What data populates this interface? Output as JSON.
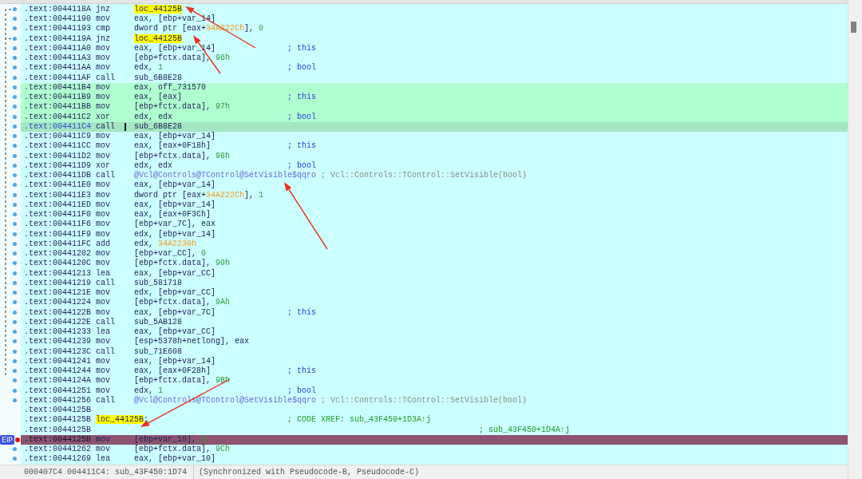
{
  "listing": {
    "rows": [
      {
        "address": ".text:0044118A",
        "mnemonic": "jnz",
        "operand": [
          {
            "text": "loc_44125B",
            "kind": "label"
          }
        ],
        "kind": "none",
        "dot": true
      },
      {
        "address": ".text:00441190",
        "mnemonic": "mov",
        "operand": [
          {
            "text": "eax, [ebp+var_14]",
            "kind": "plain"
          }
        ],
        "kind": "none",
        "dot": true
      },
      {
        "address": ".text:00441193",
        "mnemonic": "cmp",
        "operand": [
          {
            "text": "dword ptr [eax+",
            "kind": "plain"
          },
          {
            "text": "34A222Ch",
            "kind": "number"
          },
          {
            "text": "], ",
            "kind": "plain"
          },
          {
            "text": "0",
            "kind": "immediate"
          }
        ],
        "kind": "none",
        "dot": true
      },
      {
        "address": ".text:0044119A",
        "mnemonic": "jnz",
        "operand": [
          {
            "text": "loc_44125B",
            "kind": "label"
          }
        ],
        "kind": "none",
        "dot": true
      },
      {
        "address": ".text:004411A0",
        "mnemonic": "mov",
        "operand": [
          {
            "text": "eax, [ebp+var_14]",
            "kind": "plain"
          }
        ],
        "comment": {
          "text": "; this",
          "kind": "hint"
        },
        "kind": "none",
        "dot": true
      },
      {
        "address": ".text:004411A3",
        "mnemonic": "mov",
        "operand": [
          {
            "text": "[ebp+fctx.data], ",
            "kind": "plain"
          },
          {
            "text": "96h",
            "kind": "immediate"
          }
        ],
        "kind": "none",
        "dot": true
      },
      {
        "address": ".text:004411AA",
        "mnemonic": "mov",
        "operand": [
          {
            "text": "edx, ",
            "kind": "plain"
          },
          {
            "text": "1",
            "kind": "immediate"
          }
        ],
        "comment": {
          "text": "; bool",
          "kind": "hint"
        },
        "kind": "none",
        "dot": true
      },
      {
        "address": ".text:004411AF",
        "mnemonic": "call",
        "operand": [
          {
            "text": "sub_6B8E28",
            "kind": "plain"
          }
        ],
        "kind": "none",
        "dot": true
      },
      {
        "address": ".text:004411B4",
        "mnemonic": "mov",
        "operand": [
          {
            "text": "eax, off_731570",
            "kind": "plain"
          }
        ],
        "kind": "block",
        "dot": true
      },
      {
        "address": ".text:004411B9",
        "mnemonic": "mov",
        "operand": [
          {
            "text": "eax, [eax]",
            "kind": "plain"
          }
        ],
        "comment": {
          "text": "; this",
          "kind": "hint"
        },
        "kind": "block",
        "dot": true
      },
      {
        "address": ".text:004411BB",
        "mnemonic": "mov",
        "operand": [
          {
            "text": "[ebp+fctx.data], ",
            "kind": "plain"
          },
          {
            "text": "97h",
            "kind": "immediate"
          }
        ],
        "kind": "block",
        "dot": true
      },
      {
        "address": ".text:004411C2",
        "mnemonic": "xor",
        "operand": [
          {
            "text": "edx, edx",
            "kind": "plain"
          }
        ],
        "comment": {
          "text": "; bool",
          "kind": "hint"
        },
        "kind": "block",
        "dot": true
      },
      {
        "address": ".text:004411C4",
        "mnemonic": "call",
        "operand": [
          {
            "text": "sub_6B8E28",
            "kind": "plain"
          }
        ],
        "kind": "cursor",
        "dot": true
      },
      {
        "address": ".text:004411C9",
        "mnemonic": "mov",
        "operand": [
          {
            "text": "eax, [ebp+var_14]",
            "kind": "plain"
          }
        ],
        "kind": "none",
        "dot": true
      },
      {
        "address": ".text:004411CC",
        "mnemonic": "mov",
        "operand": [
          {
            "text": "eax, [eax+0F18h]",
            "kind": "plain"
          }
        ],
        "comment": {
          "text": "; this",
          "kind": "hint"
        },
        "kind": "none",
        "dot": true
      },
      {
        "address": ".text:004411D2",
        "mnemonic": "mov",
        "operand": [
          {
            "text": "[ebp+fctx.data], ",
            "kind": "plain"
          },
          {
            "text": "98h",
            "kind": "immediate"
          }
        ],
        "kind": "none",
        "dot": true
      },
      {
        "address": ".text:004411D9",
        "mnemonic": "xor",
        "operand": [
          {
            "text": "edx, edx",
            "kind": "plain"
          }
        ],
        "comment": {
          "text": "; bool",
          "kind": "hint"
        },
        "kind": "none",
        "dot": true
      },
      {
        "address": ".text:004411DB",
        "mnemonic": "call",
        "operand": [
          {
            "text": "@Vcl@Controls@TControl@SetVisible$qqro",
            "kind": "import"
          }
        ],
        "comment": {
          "text": "; Vcl::Controls::TControl::SetVisible(bool)",
          "kind": "auto"
        },
        "kind": "none",
        "dot": true
      },
      {
        "address": ".text:004411E0",
        "mnemonic": "mov",
        "operand": [
          {
            "text": "eax, [ebp+var_14]",
            "kind": "plain"
          }
        ],
        "kind": "none",
        "dot": true
      },
      {
        "address": ".text:004411E3",
        "mnemonic": "mov",
        "operand": [
          {
            "text": "dword ptr [eax+",
            "kind": "plain"
          },
          {
            "text": "34A222Ch",
            "kind": "number"
          },
          {
            "text": "], ",
            "kind": "plain"
          },
          {
            "text": "1",
            "kind": "immediate"
          }
        ],
        "kind": "none",
        "dot": true
      },
      {
        "address": ".text:004411ED",
        "mnemonic": "mov",
        "operand": [
          {
            "text": "eax, [ebp+var_14]",
            "kind": "plain"
          }
        ],
        "kind": "none",
        "dot": true
      },
      {
        "address": ".text:004411F0",
        "mnemonic": "mov",
        "operand": [
          {
            "text": "eax, [eax+0F3Ch]",
            "kind": "plain"
          }
        ],
        "kind": "none",
        "dot": true
      },
      {
        "address": ".text:004411F6",
        "mnemonic": "mov",
        "operand": [
          {
            "text": "[ebp+var_7C], eax",
            "kind": "plain"
          }
        ],
        "kind": "none",
        "dot": true
      },
      {
        "address": ".text:004411F9",
        "mnemonic": "mov",
        "operand": [
          {
            "text": "edx, [ebp+var_14]",
            "kind": "plain"
          }
        ],
        "kind": "none",
        "dot": true
      },
      {
        "address": ".text:004411FC",
        "mnemonic": "add",
        "operand": [
          {
            "text": "edx, ",
            "kind": "plain"
          },
          {
            "text": "34A2230h",
            "kind": "number"
          }
        ],
        "kind": "none",
        "dot": true
      },
      {
        "address": ".text:00441202",
        "mnemonic": "mov",
        "operand": [
          {
            "text": "[ebp+var_CC], ",
            "kind": "plain"
          },
          {
            "text": "0",
            "kind": "immediate"
          }
        ],
        "kind": "none",
        "dot": true
      },
      {
        "address": ".text:0044120C",
        "mnemonic": "mov",
        "operand": [
          {
            "text": "[ebp+fctx.data], ",
            "kind": "plain"
          },
          {
            "text": "99h",
            "kind": "immediate"
          }
        ],
        "kind": "none",
        "dot": true
      },
      {
        "address": ".text:00441213",
        "mnemonic": "lea",
        "operand": [
          {
            "text": "eax, [ebp+var_CC]",
            "kind": "plain"
          }
        ],
        "kind": "none",
        "dot": true
      },
      {
        "address": ".text:00441219",
        "mnemonic": "call",
        "operand": [
          {
            "text": "sub_581718",
            "kind": "plain"
          }
        ],
        "kind": "none",
        "dot": true
      },
      {
        "address": ".text:0044121E",
        "mnemonic": "mov",
        "operand": [
          {
            "text": "edx, [ebp+var_CC]",
            "kind": "plain"
          }
        ],
        "kind": "none",
        "dot": true
      },
      {
        "address": ".text:00441224",
        "mnemonic": "mov",
        "operand": [
          {
            "text": "[ebp+fctx.data], ",
            "kind": "plain"
          },
          {
            "text": "9Ah",
            "kind": "immediate"
          }
        ],
        "kind": "none",
        "dot": true
      },
      {
        "address": ".text:0044122B",
        "mnemonic": "mov",
        "operand": [
          {
            "text": "eax, [ebp+var_7C]",
            "kind": "plain"
          }
        ],
        "comment": {
          "text": "; this",
          "kind": "hint"
        },
        "kind": "none",
        "dot": true
      },
      {
        "address": ".text:0044122E",
        "mnemonic": "call",
        "operand": [
          {
            "text": "sub_5AB128",
            "kind": "plain"
          }
        ],
        "kind": "none",
        "dot": true
      },
      {
        "address": ".text:00441233",
        "mnemonic": "lea",
        "operand": [
          {
            "text": "eax, [ebp+var_CC]",
            "kind": "plain"
          }
        ],
        "kind": "none",
        "dot": true
      },
      {
        "address": ".text:00441239",
        "mnemonic": "mov",
        "operand": [
          {
            "text": "[esp+5378h+netlong], eax",
            "kind": "plain"
          }
        ],
        "kind": "none",
        "dot": true
      },
      {
        "address": ".text:0044123C",
        "mnemonic": "call",
        "operand": [
          {
            "text": "sub_71E608",
            "kind": "plain"
          }
        ],
        "kind": "none",
        "dot": true
      },
      {
        "address": ".text:00441241",
        "mnemonic": "mov",
        "operand": [
          {
            "text": "eax, [ebp+var_14]",
            "kind": "plain"
          }
        ],
        "kind": "none",
        "dot": true
      },
      {
        "address": ".text:00441244",
        "mnemonic": "mov",
        "operand": [
          {
            "text": "eax, [eax+0F28h]",
            "kind": "plain"
          }
        ],
        "comment": {
          "text": "; this",
          "kind": "hint"
        },
        "kind": "none",
        "dot": true
      },
      {
        "address": ".text:0044124A",
        "mnemonic": "mov",
        "operand": [
          {
            "text": "[ebp+fctx.data], ",
            "kind": "plain"
          },
          {
            "text": "9Bh",
            "kind": "immediate"
          }
        ],
        "kind": "none",
        "dot": true
      },
      {
        "address": ".text:00441251",
        "mnemonic": "mov",
        "operand": [
          {
            "text": "edx, ",
            "kind": "plain"
          },
          {
            "text": "1",
            "kind": "immediate"
          }
        ],
        "comment": {
          "text": "; bool",
          "kind": "hint"
        },
        "kind": "none",
        "dot": true
      },
      {
        "address": ".text:00441256",
        "mnemonic": "call",
        "operand": [
          {
            "text": "@Vcl@Controls@TControl@SetVisible$qqro",
            "kind": "import"
          }
        ],
        "comment": {
          "text": "; Vcl::Controls::TControl::SetVisible(bool)",
          "kind": "auto"
        },
        "kind": "none",
        "dot": true
      },
      {
        "address": ".text:0044125B",
        "kind": "none",
        "dot": false
      },
      {
        "address": ".text:0044125B",
        "label": [
          {
            "text": "loc_44125B",
            "kind": "label"
          },
          {
            "text": ":",
            "kind": "plain"
          }
        ],
        "comment": {
          "text": "; CODE XREF: sub_43F450+1D3A↑j",
          "kind": "xref"
        },
        "kind": "none",
        "dot": false
      },
      {
        "address": ".text:0044125B",
        "comment": {
          "text": "; sub_43F450+1D4A↑j",
          "kind": "xref"
        },
        "kind": "none",
        "dot": false
      },
      {
        "address": ".text:0044125B",
        "mnemonic": "mov",
        "operand": [
          {
            "text": "[ebp+var_10], ",
            "kind": "plain"
          },
          {
            "text": "0",
            "kind": "immediate"
          }
        ],
        "kind": "eip",
        "badge": "EIP",
        "dot": false
      },
      {
        "address": ".text:00441262",
        "mnemonic": "mov",
        "operand": [
          {
            "text": "[ebp+fctx.data], ",
            "kind": "plain"
          },
          {
            "text": "9Ch",
            "kind": "immediate"
          }
        ],
        "kind": "none",
        "dot": true
      },
      {
        "address": ".text:00441269",
        "mnemonic": "lea",
        "operand": [
          {
            "text": "eax, [ebp+var_10]",
            "kind": "plain"
          }
        ],
        "kind": "none",
        "dot": true
      }
    ]
  },
  "status_bar": {
    "position": "000407C4 004411C4: sub_43F450:1D74",
    "sync": "(Synchronized with Pseudocode-B, Pseudocode-C)"
  }
}
